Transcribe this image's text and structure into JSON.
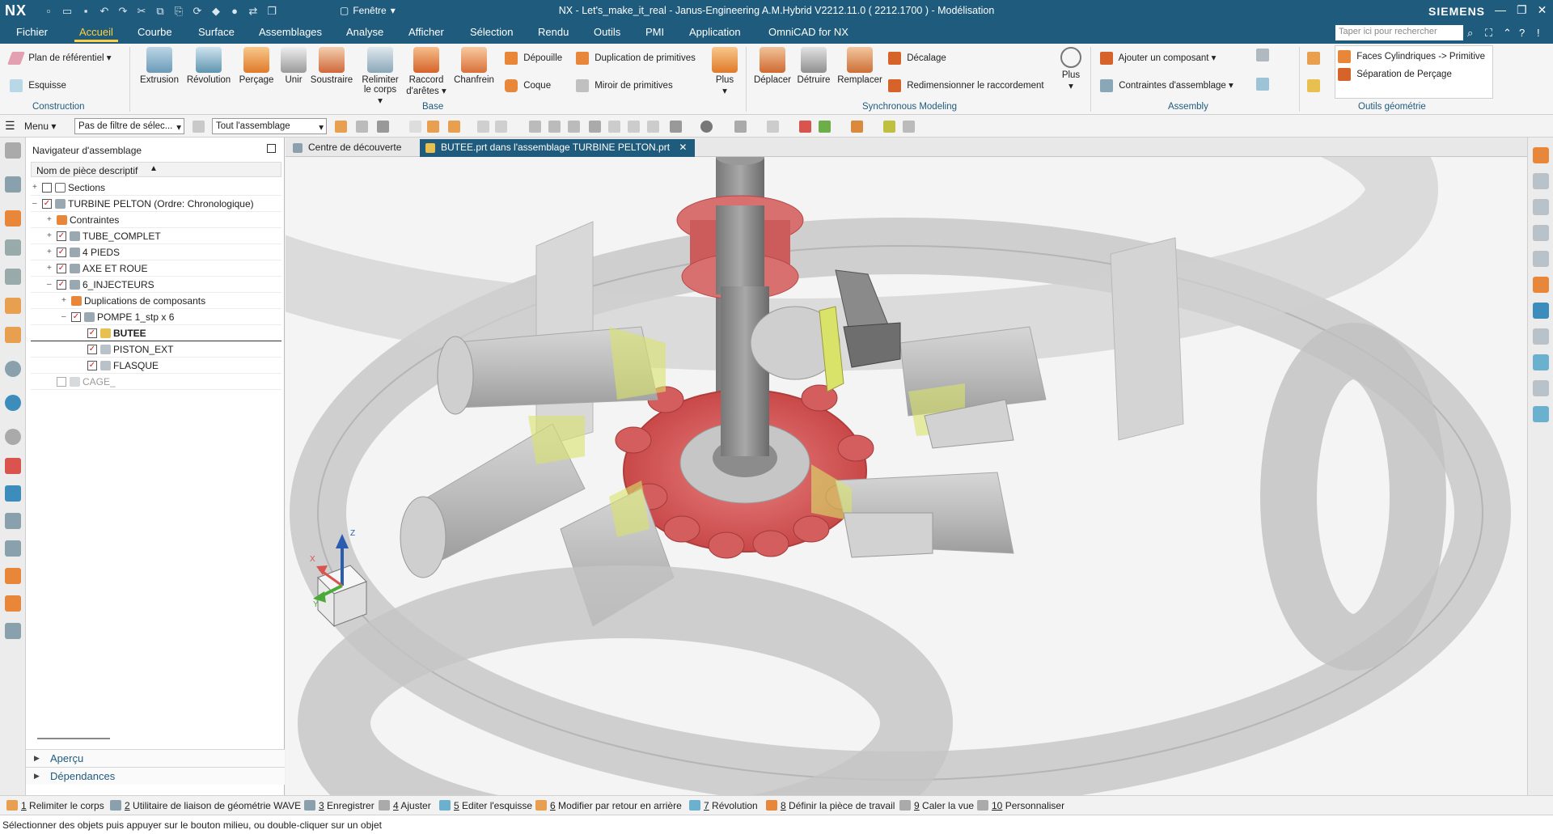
{
  "app": {
    "logo": "NX",
    "title": "NX - Let's_make_it_real - Janus-Engineering A.M.Hybrid V2212.11.0 ( 2212.1700 ) - Modélisation",
    "brand": "SIEMENS",
    "window_menu": "Fenêtre",
    "search_placeholder": "Taper ici pour rechercher"
  },
  "menu_tabs": [
    {
      "label": "Fichier"
    },
    {
      "label": "Accueil",
      "active": true
    },
    {
      "label": "Courbe"
    },
    {
      "label": "Surface"
    },
    {
      "label": "Assemblages"
    },
    {
      "label": "Analyse"
    },
    {
      "label": "Afficher"
    },
    {
      "label": "Sélection"
    },
    {
      "label": "Rendu"
    },
    {
      "label": "Outils"
    },
    {
      "label": "PMI"
    },
    {
      "label": "Application"
    },
    {
      "label": "OmniCAD for NX"
    }
  ],
  "ribbon": {
    "construction": {
      "plan": "Plan de référentiel",
      "esquisse": "Esquisse",
      "label": "Construction"
    },
    "base": {
      "extrusion": "Extrusion",
      "revolution": "Révolution",
      "percage": "Perçage",
      "unir": "Unir",
      "soustraire": "Soustraire",
      "relimiter_1": "Relimiter",
      "relimiter_2": "le corps",
      "raccord_1": "Raccord",
      "raccord_2": "d'arêtes",
      "chanfrein": "Chanfrein",
      "depouille": "Dépouille",
      "coque": "Coque",
      "duplication": "Duplication de primitives",
      "miroir": "Miroir de primitives",
      "plus": "Plus",
      "label": "Base"
    },
    "synchronous": {
      "deplacer": "Déplacer",
      "detruire": "Détruire",
      "remplacer": "Remplacer",
      "decalage": "Décalage",
      "redimensionner": "Redimensionner le raccordement",
      "plus": "Plus",
      "label": "Synchronous Modeling"
    },
    "assembly": {
      "ajouter": "Ajouter un composant",
      "contraintes": "Contraintes d'assemblage",
      "label": "Assembly"
    },
    "outils": {
      "faces": "Faces Cylindriques -> Primitive",
      "separation": "Séparation de Perçage",
      "label": "Outils géométrie"
    }
  },
  "toolbar": {
    "menu": "Menu",
    "filter": "Pas de filtre de sélec...",
    "scope": "Tout l'assemblage"
  },
  "navigator": {
    "title": "Navigateur d'assemblage",
    "column": "Nom de pièce descriptif",
    "rows": [
      {
        "label": "Sections",
        "checked": false
      },
      {
        "label": "TURBINE PELTON (Ordre: Chronologique)",
        "checked": true
      },
      {
        "label": "Contraintes",
        "checked": false
      },
      {
        "label": "TUBE_COMPLET",
        "checked": true
      },
      {
        "label": "4 PIEDS",
        "checked": true
      },
      {
        "label": "AXE ET ROUE",
        "checked": true
      },
      {
        "label": "6_INJECTEURS",
        "checked": true
      },
      {
        "label": "Duplications de composants",
        "checked": false
      },
      {
        "label": "POMPE 1_stp x 6",
        "checked": true
      },
      {
        "label": "BUTEE",
        "checked": true
      },
      {
        "label": "PISTON_EXT",
        "checked": true
      },
      {
        "label": "FLASQUE",
        "checked": true
      },
      {
        "label": "CAGE_",
        "checked": false
      }
    ],
    "footer": [
      "Aperçu",
      "Dépendances"
    ]
  },
  "doc_tabs": [
    {
      "label": "Centre de découverte"
    },
    {
      "label": "BUTEE.prt dans l'assemblage TURBINE PELTON.prt",
      "active": true,
      "close": "✕"
    }
  ],
  "triad": {
    "x": "X",
    "y": "Y",
    "z": "Z"
  },
  "quick_access": [
    {
      "num": "1",
      "label": "Relimiter le corps"
    },
    {
      "num": "2",
      "label": "Utilitaire de liaison de géométrie WAVE"
    },
    {
      "num": "3",
      "label": "Enregistrer"
    },
    {
      "num": "4",
      "label": "Ajuster"
    },
    {
      "num": "5",
      "label": "Editer l'esquisse"
    },
    {
      "num": "6",
      "label": "Modifier par retour en arrière"
    },
    {
      "num": "7",
      "label": "Révolution"
    },
    {
      "num": "8",
      "label": "Définir la pièce de travail"
    },
    {
      "num": "9",
      "label": "Caler la vue"
    },
    {
      "num": "10",
      "label": "Personnaliser"
    }
  ],
  "status": "Sélectionner des objets puis appuyer sur le bouton milieu, ou double-cliquer sur un objet",
  "colors": {
    "accent": "#1f5b7d",
    "active_tab": "#ffcf3f",
    "wheel": "#d9534f",
    "highlight": "#d9e36a"
  }
}
